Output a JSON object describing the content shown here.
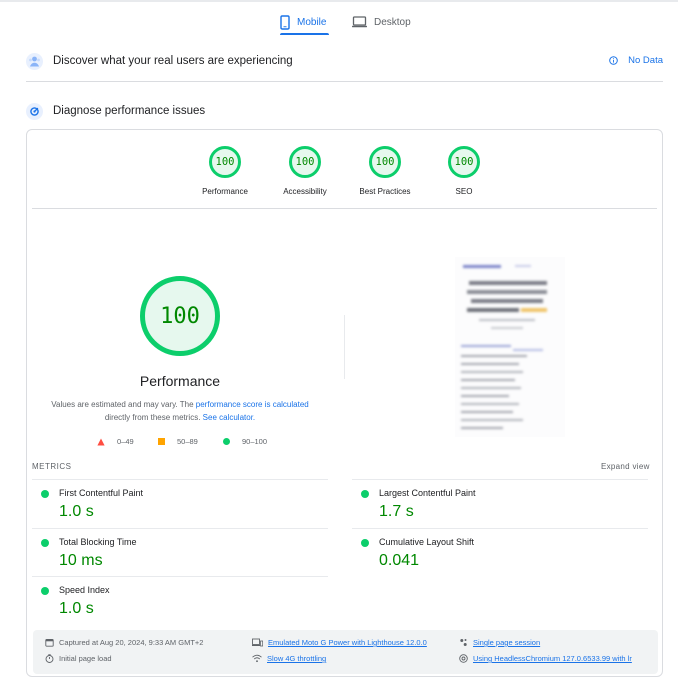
{
  "tabs": [
    {
      "label": "Mobile",
      "active": true,
      "icon": "phone-icon"
    },
    {
      "label": "Desktop",
      "active": false,
      "icon": "monitor-icon"
    }
  ],
  "field_data": {
    "title": "Discover what your real users are experiencing",
    "no_data_label": "No Data"
  },
  "diagnose": {
    "title": "Diagnose performance issues"
  },
  "categories": [
    {
      "score": "100",
      "label": "Performance"
    },
    {
      "score": "100",
      "label": "Accessibility"
    },
    {
      "score": "100",
      "label": "Best Practices"
    },
    {
      "score": "100",
      "label": "SEO"
    }
  ],
  "performance": {
    "score": "100",
    "title": "Performance",
    "desc_part1": "Values are estimated and may vary. The ",
    "desc_link1": "performance score is calculated",
    "desc_part2": " directly from these metrics. ",
    "desc_link2": "See calculator."
  },
  "legend": {
    "fail": "0–49",
    "average": "50–89",
    "pass": "90–100"
  },
  "metrics": {
    "header": "METRICS",
    "expand_label": "Expand view",
    "items": [
      {
        "name": "First Contentful Paint",
        "value": "1.0 s"
      },
      {
        "name": "Largest Contentful Paint",
        "value": "1.7 s"
      },
      {
        "name": "Total Blocking Time",
        "value": "10 ms"
      },
      {
        "name": "Cumulative Layout Shift",
        "value": "0.041"
      },
      {
        "name": "Speed Index",
        "value": "1.0 s"
      }
    ]
  },
  "footer": {
    "captured": "Captured at Aug 20, 2024, 9:33 AM GMT+2",
    "load": "Initial page load",
    "device": "Emulated Moto G Power with Lighthouse 12.0.0",
    "throttling": "Slow 4G throttling",
    "session": "Single page session",
    "browser": "Using HeadlessChromium 127.0.6533.99 with lr"
  },
  "colors": {
    "accent": "#1a73e8",
    "pass": "#0cce6b",
    "pass_text": "#008800",
    "fail": "#ff4e42",
    "average": "#ffa400"
  }
}
